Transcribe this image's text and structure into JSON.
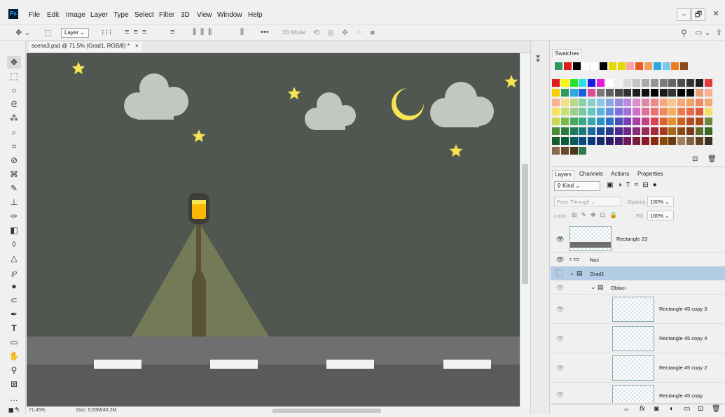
{
  "app": {
    "logo": "Ps"
  },
  "menu": [
    "File",
    "Edit",
    "Image",
    "Layer",
    "Type",
    "Select",
    "Filter",
    "3D",
    "View",
    "Window",
    "Help"
  ],
  "window_controls": {
    "minimize": "–",
    "restore": "🗗",
    "close": "✕"
  },
  "options": {
    "layer_dropdown": "Layer",
    "more": "•••",
    "mode_3d": "3D Mode:"
  },
  "document": {
    "tab_title": "scena3.psd @ 71,5% (Grad1, RGB/8) *",
    "close": "×"
  },
  "status": {
    "zoom": "71,45%",
    "doc": "Doc: 5,93M/40,2M"
  },
  "swatches": {
    "tab": "Swatches",
    "recent": [
      "#2e9b5b",
      "#e01b1b",
      "#000000",
      "#ffffff",
      "#ffffff",
      "#000000",
      "#e6d800",
      "#e6d800",
      "#f7a8a8",
      "#e85a1e",
      "#f29f5c",
      "#2ca8e0",
      "#7ac6ef",
      "#f07b1f",
      "#8a4a1c"
    ],
    "grid": [
      [
        "#e01b1b",
        "#f7f700",
        "#2ee02e",
        "#2ee0e0",
        "#1b1be0",
        "#e01be0",
        "#ffffff",
        "#f2f2f2",
        "#d9d9d9",
        "#c2c2c2",
        "#aaaaaa",
        "#939393",
        "#7c7c7c",
        "#646464",
        "#4c4c4c",
        "#353535",
        "#1e1e1e",
        "#e03c3c"
      ],
      [
        "#f7d000",
        "#2e9b5b",
        "#2ca8e0",
        "#1b5ee0",
        "#e04a9b",
        "#7a7a7a",
        "#616161",
        "#494949",
        "#333333",
        "#1e1e1e",
        "#0f0f0f",
        "#000000",
        "#1a1a1a",
        "#333333",
        "#000000",
        "#0a0a0a",
        "#e8a07a",
        "#f7b090"
      ],
      [
        "#f7b090",
        "#f7e08a",
        "#b8d98a",
        "#8ad0a8",
        "#8ad0c8",
        "#8ac8e8",
        "#8aa8e0",
        "#9a8ae0",
        "#b88ae0",
        "#e08ad0",
        "#e08aa8",
        "#f08a8a",
        "#f7a87a",
        "#f7c88a",
        "#f7a87a",
        "#f0a060",
        "#f08a60",
        "#f0a870"
      ],
      [
        "#f7e060",
        "#c8e070",
        "#9ad08a",
        "#7ac8a0",
        "#60c8c0",
        "#60b0e0",
        "#6090e0",
        "#7a70d8",
        "#a070d8",
        "#d070c8",
        "#e07098",
        "#f07070",
        "#f08a5a",
        "#f0b060",
        "#f07a50",
        "#e86a4a",
        "#e05a3a",
        "#f0e060"
      ],
      [
        "#c8d850",
        "#7ab84a",
        "#4aa85a",
        "#3aa888",
        "#3aa8a8",
        "#2a90c8",
        "#2a70c8",
        "#4a50b8",
        "#7a40b8",
        "#a840a8",
        "#c84080",
        "#e04050",
        "#e06030",
        "#e09030",
        "#c86020",
        "#b05020",
        "#a84a1a",
        "#6a8a3a"
      ],
      [
        "#4a8a3a",
        "#2a7a3a",
        "#1a7a5a",
        "#1a7a7a",
        "#1a6a9a",
        "#1a4a9a",
        "#2a3a8a",
        "#4a2a8a",
        "#6a2a8a",
        "#8a2a7a",
        "#9a2a5a",
        "#a82a3a",
        "#a83a1a",
        "#a86a1a",
        "#8a4a1a",
        "#7a3a1a",
        "#5a6a2a",
        "#3a6a2a"
      ],
      [
        "#1a5a2a",
        "#0a5a3a",
        "#0a5a5a",
        "#0a4a7a",
        "#0a3a7a",
        "#1a2a6a",
        "#2a1a6a",
        "#4a1a6a",
        "#6a1a5a",
        "#7a1a3a",
        "#8a1a2a",
        "#8a2a0a",
        "#8a4a0a",
        "#6a3a0a",
        "#a08060",
        "#806040",
        "#604020",
        "#403020"
      ],
      [
        "#8a6a4a",
        "#6a4a2a",
        "#4a3a1a",
        "#2e7a4a"
      ]
    ]
  },
  "layers": {
    "tabs": [
      "Layers",
      "Channels",
      "Actions",
      "Properties"
    ],
    "filter_kind": "Kind",
    "blend_mode": "Pass Through",
    "opacity_label": "Opacity:",
    "opacity_value": "100%",
    "lock_label": "Lock:",
    "fill_label": "Fill:",
    "fill_value": "100%",
    "rows": [
      {
        "name": "Rectangle 23"
      },
      {
        "name": "Noć"
      },
      {
        "name": "Grad1"
      },
      {
        "name": "Oblaci"
      },
      {
        "name": "Rectangle 45 copy 3"
      },
      {
        "name": "Rectangle 45 copy 4"
      },
      {
        "name": "Rectangle 45 copy 2"
      },
      {
        "name": "Rectangle 45 copy"
      }
    ],
    "bottom_icons": [
      "link-icon",
      "fx-icon",
      "mask-icon",
      "adjustment-icon",
      "folder-icon",
      "new-layer-icon",
      "trash-icon"
    ]
  },
  "colors": {
    "canvas_bg": "#505650",
    "star": "#f7e353",
    "cloud": "#c3c7c2",
    "road": "#6f6f6f",
    "road_dark": "#5a5a5a",
    "lamp_light": "#fbb800",
    "light_cone": "#737a55",
    "selection": "#b3cde6"
  }
}
